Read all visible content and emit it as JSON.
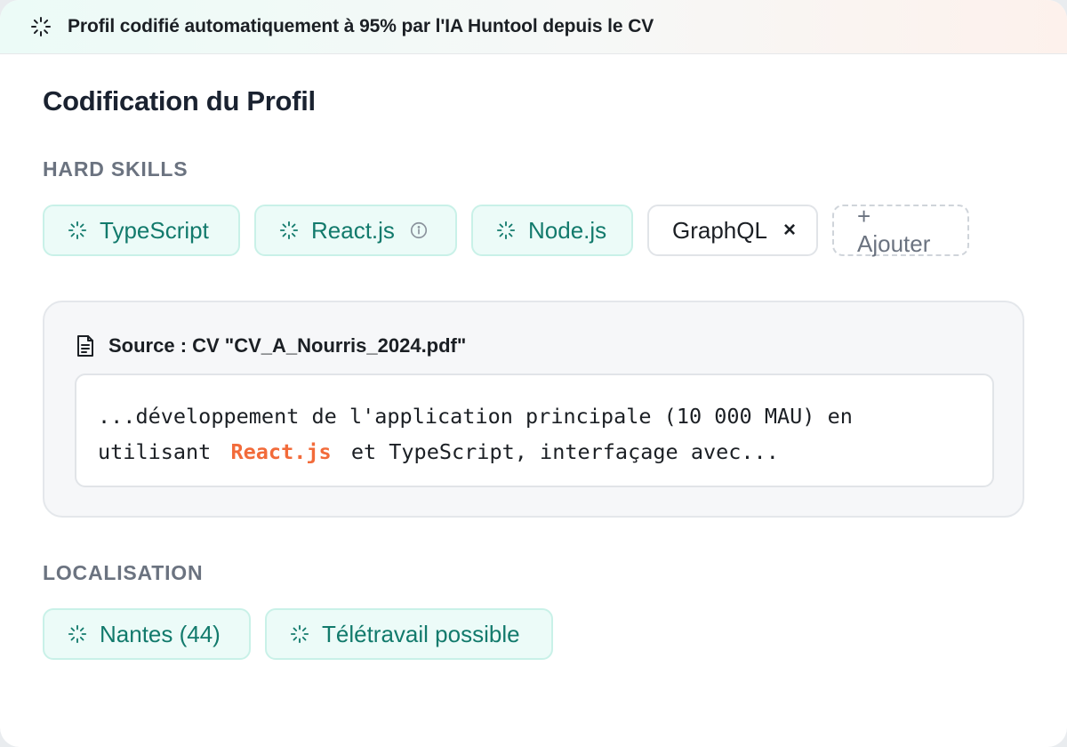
{
  "banner": {
    "text": "Profil codifié automatiquement à 95% par l'IA Huntool depuis le CV",
    "icon": "loader-icon"
  },
  "title": "Codification du Profil",
  "hard_skills": {
    "label": "HARD SKILLS",
    "chips": [
      {
        "label": "TypeScript",
        "icon": "loader-icon"
      },
      {
        "label": "React.js",
        "icon": "loader-icon",
        "trailing_icon": "info-icon"
      },
      {
        "label": "Node.js",
        "icon": "loader-icon"
      }
    ],
    "manual_chip": {
      "label": "GraphQL",
      "remove": "×"
    },
    "add_label": "+ Ajouter"
  },
  "source": {
    "title": "Source : CV \"CV_A_Nourris_2024.pdf\"",
    "icon": "document-icon",
    "excerpt_before": "...développement de l'application principale (10 000 MAU) en utilisant ",
    "excerpt_highlight": "React.js",
    "excerpt_after": " et TypeScript, interfaçage avec..."
  },
  "localisation": {
    "label": "LOCALISATION",
    "chips": [
      {
        "label": "Nantes (44)",
        "icon": "loader-icon"
      },
      {
        "label": "Télétravail possible",
        "icon": "loader-icon"
      }
    ]
  },
  "colors": {
    "accent_teal": "#127a6c",
    "chip_bg": "#ecfbf8",
    "highlight": "#f26b3a"
  }
}
